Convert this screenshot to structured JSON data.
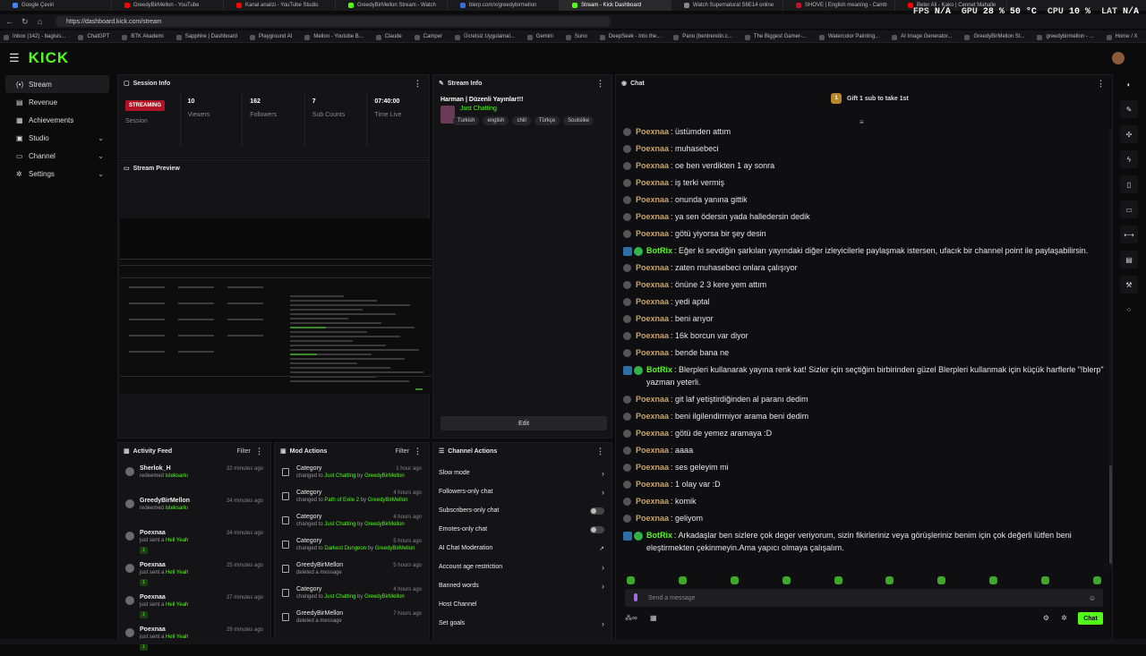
{
  "browser": {
    "tabs": [
      {
        "title": "Google Çeviri",
        "color": "#4285f4"
      },
      {
        "title": "GreedyBirMellon - YouTube",
        "color": "#ff0000"
      },
      {
        "title": "Kanal analizi - YouTube Studio",
        "color": "#ff0000"
      },
      {
        "title": "GreedyBirMellon Stream - Watch",
        "color": "#53fc18"
      },
      {
        "title": "blerp.com/x/greedybirmellon",
        "color": "#3b6fd8"
      },
      {
        "title": "Stream - Kick Dashboard",
        "color": "#53fc18"
      },
      {
        "title": "Watch Supernatural S6E14 online",
        "color": "#888888"
      },
      {
        "title": "SHOVE | English meaning - Camb",
        "color": "#c8102e"
      },
      {
        "title": "Beter Ali - Kako | Cennet Mahalle",
        "color": "#ff0000"
      }
    ],
    "active_tab": 5,
    "url": "https://dashboard.kick.com/stream",
    "bookmarks": [
      "Inbox (142) - bagisis...",
      "ChatGPT",
      "BTK Akademi",
      "Sapphire | Dashboard",
      "Playground AI",
      "Mellon - Youtube B...",
      "Claude",
      "Camper",
      "Ücretsiz Uygulamal...",
      "Gemini",
      "Suno",
      "DeepSeek - Into the...",
      "Pano (bentrendin.c...",
      "The Biggest Gamer-...",
      "Watercolor Painting...",
      "AI Image Generator...",
      "GreedyBirMellon St...",
      "greedybirmellon - ...",
      "Home / X"
    ]
  },
  "osd": {
    "fps_label": "FPS",
    "fps": "N/A",
    "gpu_label": "GPU",
    "gpu": "28 % 50 °C",
    "cpu_label": "CPU",
    "cpu": "10 %",
    "lat_label": "LAT",
    "lat": "N/A"
  },
  "header": {
    "logo": "KICK"
  },
  "sidebar": {
    "items": [
      {
        "label": "Stream",
        "icon": "(•)",
        "active": true
      },
      {
        "label": "Revenue",
        "icon": "▤"
      },
      {
        "label": "Achievements",
        "icon": "▦"
      },
      {
        "label": "Studio",
        "icon": "▣",
        "chevron": true
      },
      {
        "label": "Channel",
        "icon": "▭",
        "chevron": true
      },
      {
        "label": "Settings",
        "icon": "✲",
        "chevron": true
      }
    ]
  },
  "session": {
    "title": "Session Info",
    "stats": [
      {
        "value": "STREAMING",
        "label": "Session"
      },
      {
        "value": "10",
        "label": "Viewers"
      },
      {
        "value": "162",
        "label": "Followers"
      },
      {
        "value": "7",
        "label": "Sub Counts"
      },
      {
        "value": "07:40:00",
        "label": "Time Live"
      }
    ]
  },
  "preview": {
    "title": "Stream Preview"
  },
  "stream_info": {
    "title": "Stream Info",
    "stream_title": "Harman | Düzenli Yayınlar!!!",
    "category": "Just Chatting",
    "tags": [
      "Turkish",
      "english",
      "chill",
      "Türkçe",
      "Soulslike"
    ],
    "edit_label": "Edit"
  },
  "activity": {
    "title": "Activity Feed",
    "filter": "Filter",
    "items": [
      {
        "name": "Sherlok_H",
        "action": "redeemed ",
        "target": "isteksarkı",
        "time": "22 minutes ago",
        "chip": ""
      },
      {
        "name": "GreedyBirMellon",
        "action": "redeemed ",
        "target": "isteksarkı",
        "time": "24 minutes ago",
        "chip": ""
      },
      {
        "name": "Poexnaa",
        "action": "just sent a ",
        "target": "Hell Yeah",
        "time": "24 minutes ago",
        "chip": "1"
      },
      {
        "name": "Poexnaa",
        "action": "just sent a ",
        "target": "Hell Yeah",
        "time": "25 minutes ago",
        "chip": "1"
      },
      {
        "name": "Poexnaa",
        "action": "just sent a ",
        "target": "Hell Yeah",
        "time": "27 minutes ago",
        "chip": "1"
      },
      {
        "name": "Poexnaa",
        "action": "just sent a ",
        "target": "Hell Yeah",
        "time": "29 minutes ago",
        "chip": "1"
      }
    ]
  },
  "mod": {
    "title": "Mod Actions",
    "filter": "Filter",
    "items": [
      {
        "title": "Category",
        "pre": "changed to ",
        "g1": "Just Chatting",
        "mid": " by ",
        "g2": "GreedyBirMellon",
        "time": "1 hour ago"
      },
      {
        "title": "Category",
        "pre": "changed to ",
        "g1": "Path of Exile 2",
        "mid": " by ",
        "g2": "GreedyBirMellon",
        "time": "4 hours ago"
      },
      {
        "title": "Category",
        "pre": "changed to ",
        "g1": "Just Chatting",
        "mid": " by ",
        "g2": "GreedyBirMellon",
        "time": "4 hours ago"
      },
      {
        "title": "Category",
        "pre": "changed to ",
        "g1": "Darkest Dungeon",
        "mid": " by ",
        "g2": "GreedyBirMellon",
        "time": "5 hours ago"
      },
      {
        "title": "GreedyBirMellon",
        "pre": "deleted a message",
        "g1": "",
        "mid": "",
        "g2": "",
        "time": "5 hours ago"
      },
      {
        "title": "Category",
        "pre": "changed to ",
        "g1": "Just Chatting",
        "mid": " by ",
        "g2": "GreedyBirMellon",
        "time": "4 hours ago"
      },
      {
        "title": "GreedyBirMellon",
        "pre": "deleted a message",
        "g1": "",
        "mid": "",
        "g2": "",
        "time": "7 hours ago"
      }
    ]
  },
  "channel_actions": {
    "title": "Channel Actions",
    "items": [
      {
        "label": "Slow mode",
        "kind": "arrow"
      },
      {
        "label": "Followers-only chat",
        "kind": "arrow"
      },
      {
        "label": "Subscribers-only chat",
        "kind": "toggle"
      },
      {
        "label": "Emotes-only chat",
        "kind": "toggle"
      },
      {
        "label": "AI Chat Moderation",
        "kind": "ext"
      },
      {
        "label": "Account age restriction",
        "kind": "arrow"
      },
      {
        "label": "Banned words",
        "kind": "arrow"
      },
      {
        "label": "Host Channel",
        "kind": "none"
      },
      {
        "label": "Set goals",
        "kind": "arrow"
      }
    ]
  },
  "chat": {
    "title": "Chat",
    "gift_rank": "1",
    "gift_text": "Gift 1 sub to take 1st",
    "input_placeholder": "Send a message",
    "send_label": "Chat",
    "messages": [
      {
        "user": "Poexnaa",
        "text": "üstümden attım"
      },
      {
        "user": "Poexnaa",
        "text": "muhasebeci"
      },
      {
        "user": "Poexnaa",
        "text": "oe ben verdikten 1 ay sonra"
      },
      {
        "user": "Poexnaa",
        "text": "iş terki vermiş"
      },
      {
        "user": "Poexnaa",
        "text": "onunda yanına gittik"
      },
      {
        "user": "Poexnaa",
        "text": "ya sen ödersin yada halledersin dedik"
      },
      {
        "user": "Poexnaa",
        "text": "götü yiyorsa bir şey desin"
      },
      {
        "user": "BotRix",
        "bot": true,
        "text": "Eğer ki sevdiğin şarkıları yayındaki diğer izleyicilerle paylaşmak istersen, ufacık bir channel point ile paylaşabilirsin."
      },
      {
        "user": "Poexnaa",
        "text": "zaten muhasebeci onlara çalışıyor"
      },
      {
        "user": "Poexnaa",
        "text": "önüne 2 3 kere yem attım"
      },
      {
        "user": "Poexnaa",
        "text": "yedi aptal"
      },
      {
        "user": "Poexnaa",
        "text": "beni arıyor"
      },
      {
        "user": "Poexnaa",
        "text": "16k borcun var diyor"
      },
      {
        "user": "Poexnaa",
        "text": "bende bana ne"
      },
      {
        "user": "BotRix",
        "bot": true,
        "text": "Blerpleri kullanarak yayına renk kat! Sizler için seçtiğim birbirinden güzel Blerpleri kullanmak için küçük harflerle \"!blerp\" yazman yeterli."
      },
      {
        "user": "Poexnaa",
        "text": "git laf yetiştirdiğinden al paranı dedim"
      },
      {
        "user": "Poexnaa",
        "text": "beni ilgilendirmiyor arama beni dedim"
      },
      {
        "user": "Poexnaa",
        "text": "götü de yemez aramaya :D"
      },
      {
        "user": "Poexnaa",
        "text": "aaaa"
      },
      {
        "user": "Poexnaa",
        "text": "ses geleyim mi"
      },
      {
        "user": "Poexnaa",
        "text": "1 olay var :D"
      },
      {
        "user": "Poexnaa",
        "text": "komik"
      },
      {
        "user": "Poexnaa",
        "text": "geliyom"
      },
      {
        "user": "BotRix",
        "bot": true,
        "text": "Arkadaşlar ben sizlere çok deger veriyorum, sizin fikirleriniz veya görüşleriniz benim için çok değerli lütfen beni eleştirmekten çekinmeyin.Ama yapıcı olmaya çalışalım."
      }
    ]
  },
  "colors": {
    "accent": "#53fc18",
    "live": "#b01323",
    "username": "#c9a46c"
  }
}
